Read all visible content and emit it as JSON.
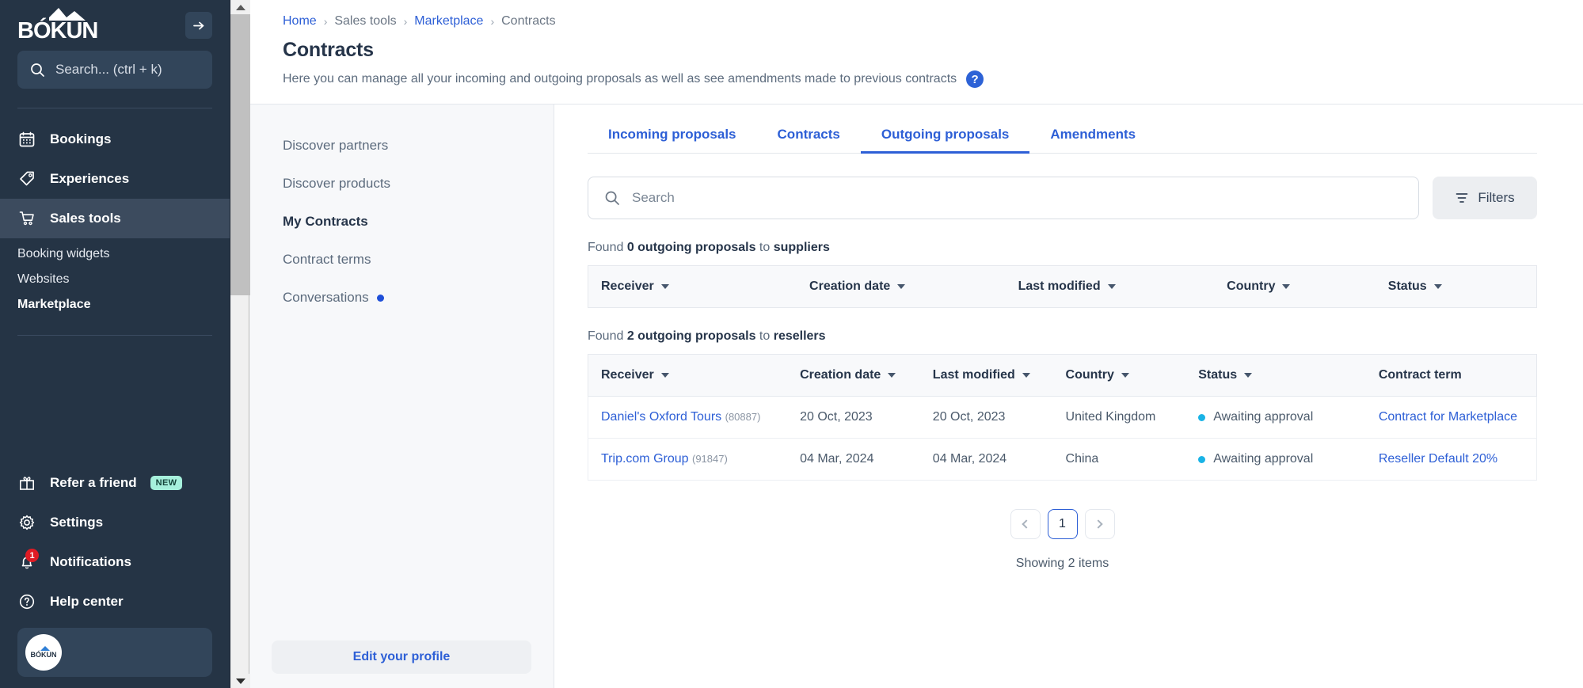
{
  "sidebar": {
    "brand": "BÓKUN",
    "collapse_icon": "arrow-right-icon",
    "search_placeholder": "Search... (ctrl + k)",
    "nav": [
      {
        "label": "Bookings",
        "icon": "calendar-icon",
        "active": false
      },
      {
        "label": "Experiences",
        "icon": "tag-icon",
        "active": false
      },
      {
        "label": "Sales tools",
        "icon": "cart-icon",
        "active": true
      }
    ],
    "sub_nav": [
      {
        "label": "Booking widgets",
        "current": false
      },
      {
        "label": "Websites",
        "current": false
      },
      {
        "label": "Marketplace",
        "current": true
      }
    ],
    "bottom_nav": [
      {
        "label": "Refer a friend",
        "icon": "gift-icon",
        "badge": "NEW"
      },
      {
        "label": "Settings",
        "icon": "gear-icon",
        "badge": ""
      },
      {
        "label": "Notifications",
        "icon": "bell-icon",
        "badge": "",
        "count": "1"
      },
      {
        "label": "Help center",
        "icon": "question-circle-icon",
        "badge": ""
      }
    ],
    "account_avatar": "bokun-logo-avatar"
  },
  "breadcrumb": [
    {
      "label": "Home",
      "link": true
    },
    {
      "label": "Sales tools",
      "link": false
    },
    {
      "label": "Marketplace",
      "link": true
    },
    {
      "label": "Contracts",
      "link": false
    }
  ],
  "header": {
    "title": "Contracts",
    "description": "Here you can manage all your incoming and outgoing proposals as well as see amendments made to previous contracts",
    "help_icon": "question-mark-icon"
  },
  "subside": {
    "items": [
      {
        "label": "Discover partners",
        "current": false,
        "dot": false
      },
      {
        "label": "Discover products",
        "current": false,
        "dot": false
      },
      {
        "label": "My Contracts",
        "current": true,
        "dot": false
      },
      {
        "label": "Contract terms",
        "current": false,
        "dot": false
      },
      {
        "label": "Conversations",
        "current": false,
        "dot": true
      }
    ],
    "edit_profile_label": "Edit your profile"
  },
  "tabs": [
    {
      "label": "Incoming proposals",
      "active": false
    },
    {
      "label": "Contracts",
      "active": false
    },
    {
      "label": "Outgoing proposals",
      "active": true
    },
    {
      "label": "Amendments",
      "active": false
    }
  ],
  "search": {
    "placeholder": "Search",
    "value": "",
    "icon": "search-icon"
  },
  "filters_button": {
    "label": "Filters",
    "icon": "filter-icon"
  },
  "suppliers_section": {
    "found_prefix": "Found ",
    "found_strong": "0 outgoing proposals",
    "found_mid": " to ",
    "found_strong2": "suppliers",
    "columns": [
      "Receiver",
      "Creation date",
      "Last modified",
      "Country",
      "Status"
    ],
    "rows": []
  },
  "resellers_section": {
    "found_prefix": "Found ",
    "found_strong": "2 outgoing proposals",
    "found_mid": " to ",
    "found_strong2": "resellers",
    "columns": [
      "Receiver",
      "Creation date",
      "Last modified",
      "Country",
      "Status",
      "Contract term"
    ],
    "rows": [
      {
        "receiver": "Daniel's Oxford Tours",
        "receiver_id": "(80887)",
        "creation_date": "20 Oct, 2023",
        "last_modified": "20 Oct, 2023",
        "country": "United Kingdom",
        "status": "Awaiting approval",
        "status_color": "#19b3e6",
        "contract_term": "Contract for Marketplace"
      },
      {
        "receiver": "Trip.com Group",
        "receiver_id": "(91847)",
        "creation_date": "04 Mar, 2024",
        "last_modified": "04 Mar, 2024",
        "country": "China",
        "status": "Awaiting approval",
        "status_color": "#19b3e6",
        "contract_term": "Reseller Default 20%"
      }
    ]
  },
  "pagination": {
    "prev_icon": "chevron-left-icon",
    "next_icon": "chevron-right-icon",
    "pages": [
      "1"
    ],
    "current_page": "1",
    "showing": "Showing 2 items"
  },
  "colors": {
    "accent": "#2d5fd6",
    "sidebar_bg": "#253445",
    "status_dot": "#19b3e6",
    "badge_new_bg": "#a6f0dc"
  }
}
